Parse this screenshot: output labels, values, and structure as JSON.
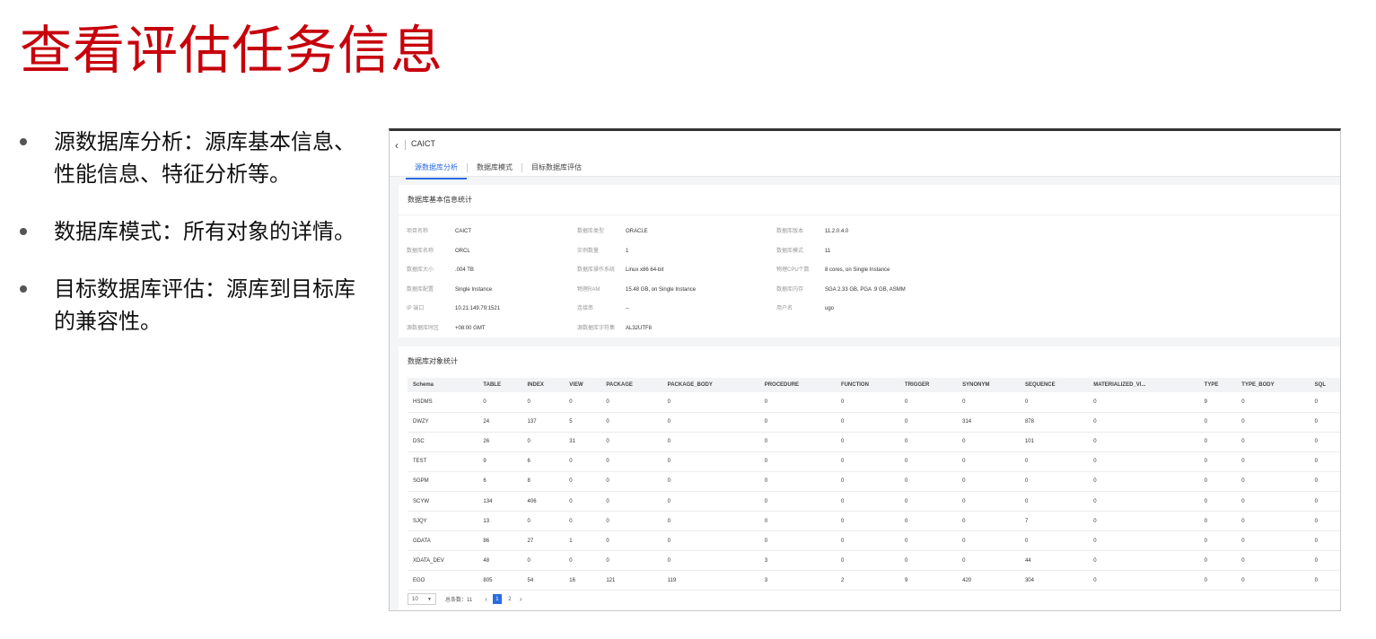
{
  "slide": {
    "title": "查看评估任务信息",
    "bullets": [
      "源数据库分析：源库基本信息、性能信息、特征分析等。",
      "数据库模式：所有对象的详情。",
      "目标数据库评估：源库到目标库的兼容性。"
    ]
  },
  "app": {
    "back_icon": "chevron-left-icon",
    "project_name": "CAICT",
    "tabs": [
      "源数据库分析",
      "数据库模式",
      "目标数据库评估"
    ],
    "active_tab": 0,
    "accent_color": "#2a6be0",
    "title_color": "#c7000b"
  },
  "basic_info": {
    "title": "数据库基本信息统计",
    "items": [
      {
        "key": "项目名称",
        "value": "CAICT"
      },
      {
        "key": "数据库类型",
        "value": "ORACLE"
      },
      {
        "key": "数据库版本",
        "value": "11.2.0.4.0"
      },
      {
        "key": "数据库名称",
        "value": "ORCL"
      },
      {
        "key": "实例数量",
        "value": "1"
      },
      {
        "key": "数据库模式",
        "value": "11"
      },
      {
        "key": "数据库大小",
        "value": ".004 TB"
      },
      {
        "key": "数据库操作系统",
        "value": "Linux x86 64-bit"
      },
      {
        "key": "物理CPU个数",
        "value": "8 cores, on Single Instance"
      },
      {
        "key": "数据库配置",
        "value": "Single Instance"
      },
      {
        "key": "物理RAM",
        "value": "15.48 GB, on Single Instance"
      },
      {
        "key": "数据库内存",
        "value": "SGA 2.33 GB, PGA .9 GB, ASMM"
      },
      {
        "key": "IP 端口",
        "value": "10.21.149.79:1521"
      },
      {
        "key": "连接串",
        "value": "--"
      },
      {
        "key": "用户名",
        "value": "ugo"
      },
      {
        "key": "源数据库时区",
        "value": "+08:00 GMT"
      },
      {
        "key": "源数据库字符集",
        "value": "AL32UTF8"
      }
    ]
  },
  "objects": {
    "title": "数据库对象统计",
    "columns": [
      "Schema",
      "TABLE",
      "INDEX",
      "VIEW",
      "PACKAGE",
      "PACKAGE_BODY",
      "PROCEDURE",
      "FUNCTION",
      "TRIGGER",
      "SYNONYM",
      "SEQUENCE",
      "MATERIALIZED_VI...",
      "TYPE",
      "TYPE_BODY",
      "SQL"
    ],
    "rows": [
      [
        "HSDMS",
        "0",
        "0",
        "0",
        "0",
        "0",
        "0",
        "0",
        "0",
        "0",
        "0",
        "0",
        "9",
        "0",
        "0"
      ],
      [
        "DWZY",
        "24",
        "137",
        "5",
        "0",
        "0",
        "0",
        "0",
        "0",
        "314",
        "878",
        "0",
        "0",
        "0",
        "0"
      ],
      [
        "DSC",
        "26",
        "0",
        "31",
        "0",
        "0",
        "0",
        "0",
        "0",
        "0",
        "101",
        "0",
        "0",
        "0",
        "0"
      ],
      [
        "TEST",
        "9",
        "6",
        "0",
        "0",
        "0",
        "0",
        "0",
        "0",
        "0",
        "0",
        "0",
        "0",
        "0",
        "0"
      ],
      [
        "SGPM",
        "6",
        "8",
        "0",
        "0",
        "0",
        "0",
        "0",
        "0",
        "0",
        "0",
        "0",
        "0",
        "0",
        "0"
      ],
      [
        "SCYW",
        "134",
        "406",
        "0",
        "0",
        "0",
        "0",
        "0",
        "0",
        "0",
        "0",
        "0",
        "0",
        "0",
        "0"
      ],
      [
        "SJQY",
        "13",
        "0",
        "0",
        "0",
        "0",
        "0",
        "0",
        "0",
        "0",
        "7",
        "0",
        "0",
        "0",
        "0"
      ],
      [
        "GDATA",
        "86",
        "27",
        "1",
        "0",
        "0",
        "0",
        "0",
        "0",
        "0",
        "0",
        "0",
        "0",
        "0",
        "0"
      ],
      [
        "XDATA_DEV",
        "48",
        "0",
        "0",
        "0",
        "0",
        "3",
        "0",
        "0",
        "0",
        "44",
        "0",
        "0",
        "0",
        "0"
      ],
      [
        "EGO",
        "805",
        "54",
        "16",
        "121",
        "119",
        "3",
        "2",
        "9",
        "420",
        "304",
        "0",
        "0",
        "0",
        "0"
      ]
    ],
    "pager": {
      "page_size": "10",
      "total_label": "总条数：11",
      "pages": [
        "1",
        "2"
      ],
      "current_page": "1"
    }
  }
}
